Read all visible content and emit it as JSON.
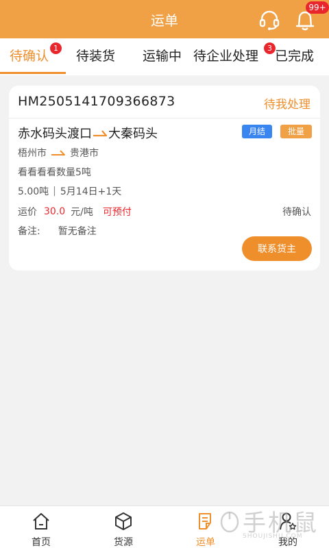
{
  "header": {
    "title": "运单",
    "service_icon": "headset-icon",
    "bell_icon": "bell-icon",
    "bell_badge": "99+",
    "bg_color": "#f0a045"
  },
  "tabs": [
    {
      "label": "待确认",
      "badge": "1",
      "active": true
    },
    {
      "label": "待装货",
      "badge": "",
      "active": false
    },
    {
      "label": "运输中",
      "badge": "",
      "active": false
    },
    {
      "label": "待企业处理",
      "badge": "3",
      "active": false
    },
    {
      "label": "已完成",
      "badge": "",
      "active": false
    }
  ],
  "order": {
    "number": "HM2505141709366873",
    "status": "待我处理",
    "from_port": "赤水码头渡口",
    "to_port": "大秦码头",
    "tag_monthly": "月结",
    "tag_bulk": "批量",
    "from_city": "梧州市",
    "to_city": "贵港市",
    "cargo_desc": "看看看看数量5吨",
    "weight": "5.00吨",
    "separator": "|",
    "date": "5月14日+1天",
    "price_label": "运价",
    "price_value": "30.0",
    "price_unit": "元/吨",
    "prepay": "可预付",
    "confirm_status": "待确认",
    "remark_label": "备注:",
    "remark_value": "暂无备注",
    "contact_button": "联系货主",
    "accent_color": "#ef8f2c",
    "alert_color": "#e8262c"
  },
  "bottom_nav": [
    {
      "label": "首页",
      "icon": "home-icon",
      "active": false
    },
    {
      "label": "货源",
      "icon": "box-icon",
      "active": false
    },
    {
      "label": "运单",
      "icon": "document-icon",
      "active": true
    },
    {
      "label": "我的",
      "icon": "user-icon",
      "active": false
    }
  ],
  "watermark": {
    "main": "手机鼠",
    "sub": "SHOUJISHU.COM"
  }
}
